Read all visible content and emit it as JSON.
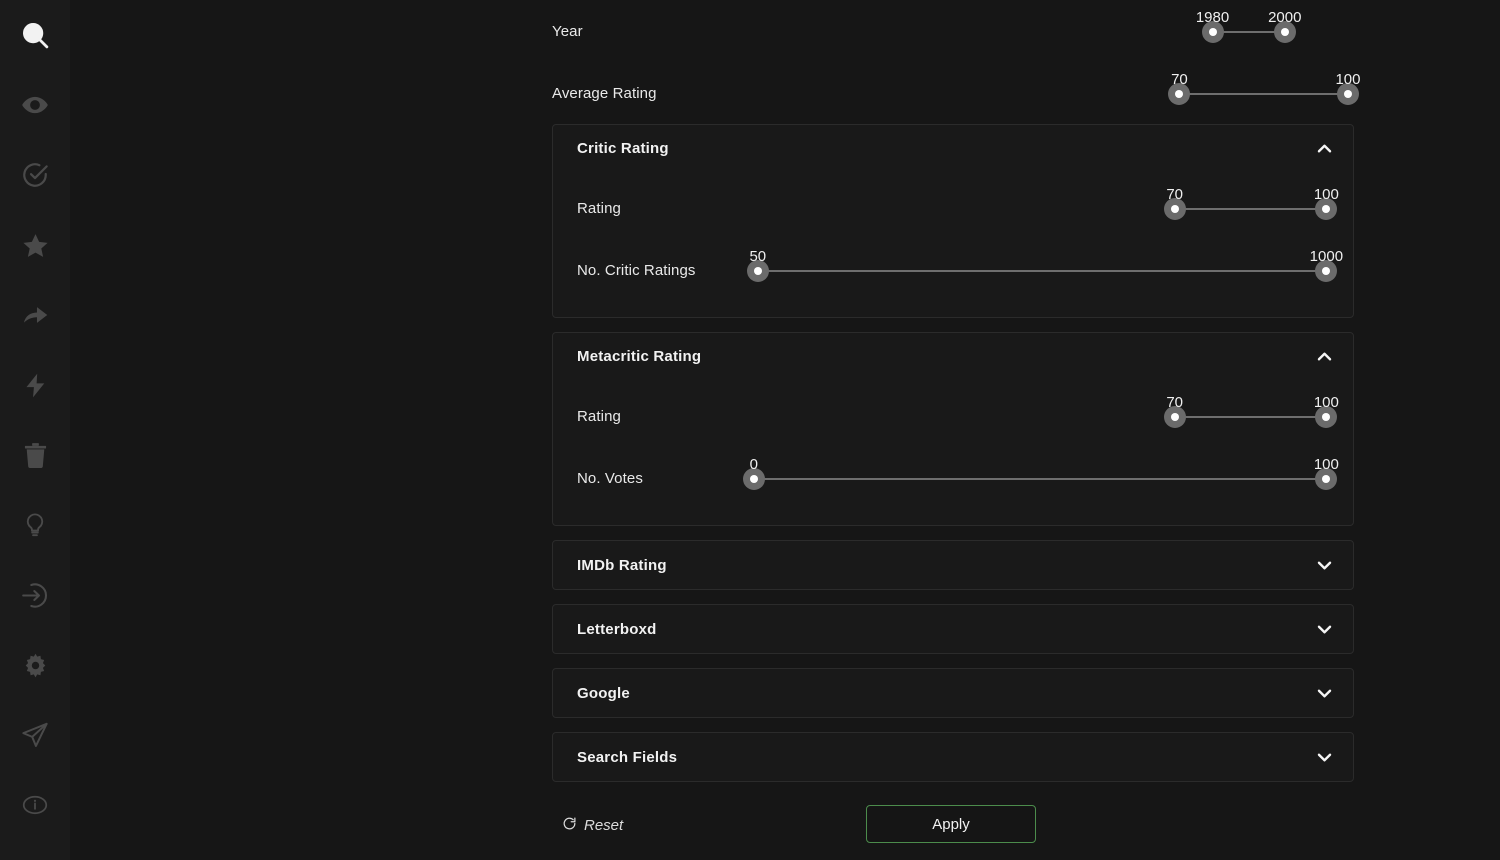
{
  "sidebar": {
    "items": [
      {
        "icon": "search-icon",
        "name": "sidebar-item-search",
        "active": true
      },
      {
        "icon": "eye-icon",
        "name": "sidebar-item-watched",
        "active": false
      },
      {
        "icon": "check-circle-icon",
        "name": "sidebar-item-watchlist",
        "active": false
      },
      {
        "icon": "star-icon",
        "name": "sidebar-item-favorites",
        "active": false
      },
      {
        "icon": "share-arrow-icon",
        "name": "sidebar-item-share",
        "active": false
      },
      {
        "icon": "lightning-icon",
        "name": "sidebar-item-quick",
        "active": false
      },
      {
        "icon": "trash-icon",
        "name": "sidebar-item-trash",
        "active": false
      },
      {
        "icon": "lightbulb-icon",
        "name": "sidebar-item-suggestions",
        "active": false
      },
      {
        "icon": "login-icon",
        "name": "sidebar-item-login",
        "active": false
      },
      {
        "icon": "gear-icon",
        "name": "sidebar-item-settings",
        "active": false
      },
      {
        "icon": "send-icon",
        "name": "sidebar-item-send",
        "active": false
      },
      {
        "icon": "info-icon",
        "name": "sidebar-item-info",
        "active": false
      }
    ]
  },
  "filters": {
    "top_rows": [
      {
        "label": "Year",
        "name": "year",
        "min_value": "1980",
        "max_value": "2000",
        "min_pct": 76.5,
        "max_pct": 88.5
      },
      {
        "label": "Average Rating",
        "name": "average-rating",
        "min_value": "70",
        "max_value": "100",
        "min_pct": 71.0,
        "max_pct": 99.0
      }
    ],
    "sections": [
      {
        "title": "Critic Rating",
        "name": "critic-rating",
        "expanded": true,
        "chevron": "chevron-up-icon",
        "rows": [
          {
            "label": "Rating",
            "name": "critic-rating-value",
            "min_value": "70",
            "max_value": "100",
            "min_pct": 73.0,
            "max_pct": 99.2
          },
          {
            "label": "No. Critic Ratings",
            "name": "no-critic-ratings",
            "min_value": "50",
            "max_value": "1000",
            "min_pct": 1.0,
            "max_pct": 99.2
          }
        ]
      },
      {
        "title": "Metacritic Rating",
        "name": "metacritic-rating",
        "expanded": true,
        "chevron": "chevron-up-icon",
        "rows": [
          {
            "label": "Rating",
            "name": "metacritic-rating-value",
            "min_value": "70",
            "max_value": "100",
            "min_pct": 73.0,
            "max_pct": 99.2
          },
          {
            "label": "No. Votes",
            "name": "metacritic-no-votes",
            "min_value": "0",
            "max_value": "100",
            "min_pct": 0.3,
            "max_pct": 99.2
          }
        ]
      },
      {
        "title": "IMDb Rating",
        "name": "imdb-rating",
        "expanded": false,
        "chevron": "chevron-down-icon",
        "rows": []
      },
      {
        "title": "Letterboxd",
        "name": "letterboxd",
        "expanded": false,
        "chevron": "chevron-down-icon",
        "rows": []
      },
      {
        "title": "Google",
        "name": "google",
        "expanded": false,
        "chevron": "chevron-down-icon",
        "rows": []
      },
      {
        "title": "Search Fields",
        "name": "search-fields",
        "expanded": false,
        "chevron": "chevron-down-icon",
        "rows": []
      }
    ]
  },
  "footer": {
    "reset_label": "Reset",
    "reset_icon": "refresh-icon",
    "apply_label": "Apply"
  },
  "colors": {
    "background": "#161616",
    "sidebar_background": "#1b1b1b",
    "panel_background": "#191919",
    "panel_border": "#2b2b2b",
    "text": "#f2f2f2",
    "slider_track": "#6e6e6e",
    "slider_knob": "#6b6b6b",
    "apply_accent": "#4c8c4c"
  }
}
